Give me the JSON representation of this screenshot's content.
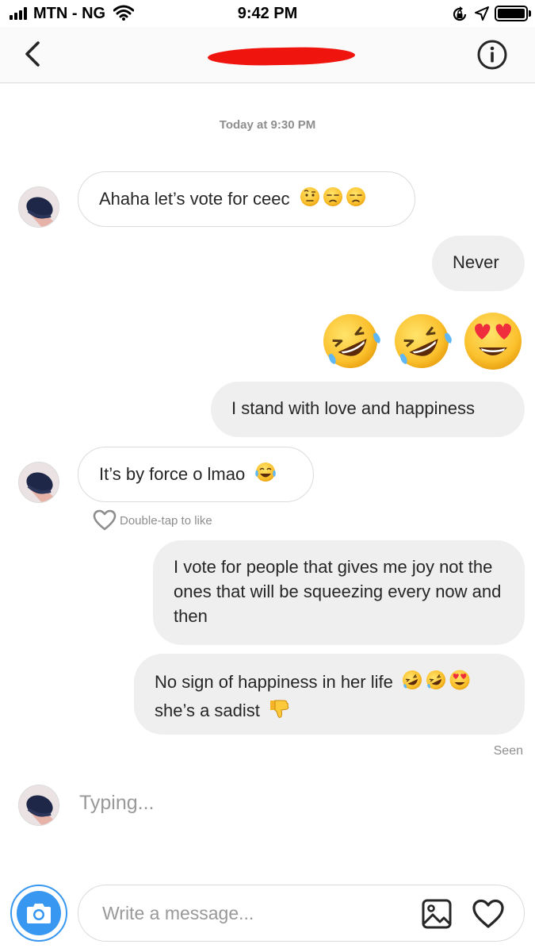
{
  "status_bar": {
    "carrier": "MTN - NG",
    "time": "9:42 PM"
  },
  "header": {
    "contact_name_redacted": true
  },
  "thread": {
    "timestamp": "Today at 9:30 PM",
    "messages": [
      {
        "from": "them",
        "text": "Ahaha let’s vote for ceec",
        "emojis": [
          "face-with-raised-eyebrow",
          "unamused-face",
          "unamused-face"
        ]
      },
      {
        "from": "me",
        "text": "Never"
      },
      {
        "from": "me",
        "emojis": [
          "rolling-on-the-floor-laughing",
          "rolling-on-the-floor-laughing",
          "smiling-face-with-heart-eyes"
        ]
      },
      {
        "from": "me",
        "text": "I stand with love and happiness"
      },
      {
        "from": "them",
        "text": "It’s by force o lmao",
        "emojis": [
          "face-with-tears-of-joy"
        ]
      },
      {
        "from": "me",
        "text": "I vote for people that gives me joy not the ones that will be squeezing every now and then"
      },
      {
        "from": "me",
        "text_line1": "No sign of happiness in her life",
        "text_line2": "she’s a sadist",
        "emojis": [
          "rolling-on-the-floor-laughing",
          "rolling-on-the-floor-laughing",
          "smiling-face-with-heart-eyes",
          "thumbs-down"
        ]
      }
    ],
    "like_hint": "Double-tap to like",
    "seen_label": "Seen",
    "typing_label": "Typing..."
  },
  "composer": {
    "placeholder": "Write a message..."
  },
  "colors": {
    "accent_blue": "#3897f0",
    "outgoing_bubble": "#efefef",
    "border": "#dbdbdb",
    "muted_text": "#8e8e8e"
  }
}
